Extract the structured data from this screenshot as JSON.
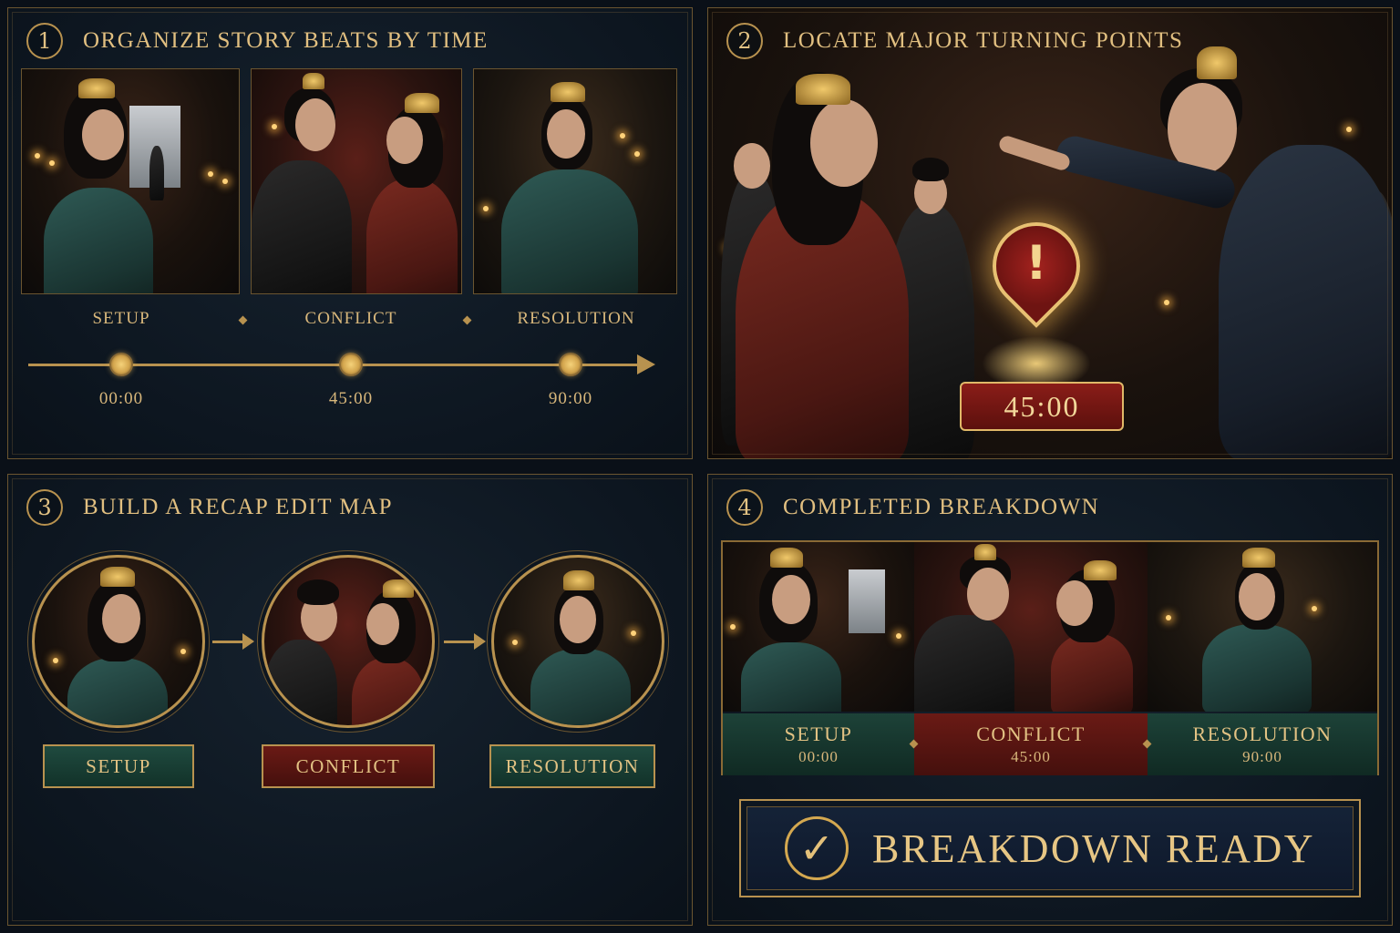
{
  "panels": [
    {
      "number": "1",
      "title": "ORGANIZE STORY BEATS BY TIME",
      "beats": [
        "SETUP",
        "CONFLICT",
        "RESOLUTION"
      ],
      "times": [
        "00:00",
        "45:00",
        "90:00"
      ]
    },
    {
      "number": "2",
      "title": "LOCATE MAJOR TURNING POINTS",
      "marker_symbol": "!",
      "marker_time": "45:00"
    },
    {
      "number": "3",
      "title": "BUILD A RECAP EDIT MAP",
      "tags": [
        "SETUP",
        "CONFLICT",
        "RESOLUTION"
      ]
    },
    {
      "number": "4",
      "title": "COMPLETED BREAKDOWN",
      "captions": [
        {
          "label": "SETUP",
          "time": "00:00"
        },
        {
          "label": "CONFLICT",
          "time": "45:00"
        },
        {
          "label": "RESOLUTION",
          "time": "90:00"
        }
      ],
      "ready_label": "BREAKDOWN READY",
      "check_symbol": "✓"
    }
  ],
  "colors": {
    "gold": "#b8924f",
    "setup_green": "#1f4a3f",
    "conflict_red": "#6a1a15",
    "ready_navy": "#152338"
  },
  "icons": [
    "alert-pin-icon",
    "check-circle-icon",
    "timeline-arrow-icon",
    "flow-arrow-icon"
  ]
}
